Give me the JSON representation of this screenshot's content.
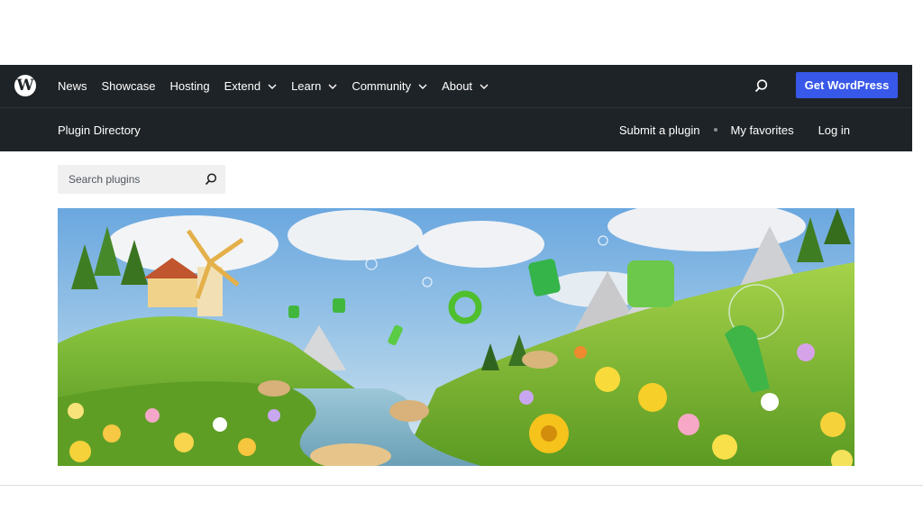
{
  "header": {
    "logo_icon": "wordpress-logo-icon",
    "logo_glyph": "W",
    "nav": [
      {
        "label": "News",
        "dropdown": false
      },
      {
        "label": "Showcase",
        "dropdown": false
      },
      {
        "label": "Hosting",
        "dropdown": false
      },
      {
        "label": "Extend",
        "dropdown": true
      },
      {
        "label": "Learn",
        "dropdown": true
      },
      {
        "label": "Community",
        "dropdown": true
      },
      {
        "label": "About",
        "dropdown": true
      }
    ],
    "search_icon": "search-icon",
    "cta_label": "Get WordPress",
    "cta_color": "#3858e9",
    "bar_color": "#1e2327"
  },
  "subheader": {
    "title": "Plugin Directory",
    "links": {
      "submit": "Submit a plugin",
      "favorites": "My favorites",
      "login": "Log in"
    }
  },
  "search": {
    "placeholder": "Search plugins",
    "value": "",
    "icon": "search-icon"
  },
  "banner": {
    "description_icon": "plugin-directory-hero-illustration"
  }
}
